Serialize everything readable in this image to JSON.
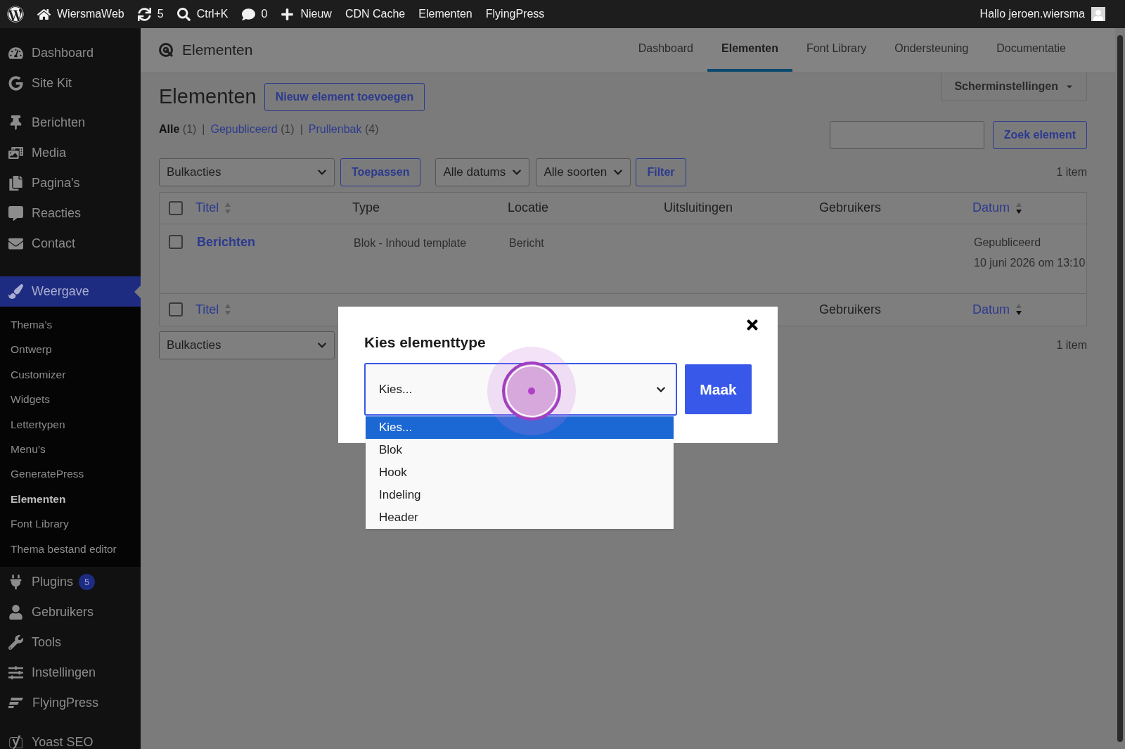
{
  "admin_bar": {
    "items": [
      {
        "kind": "logo"
      },
      {
        "kind": "home",
        "label": "WiersmaWeb"
      },
      {
        "kind": "updates",
        "label": "5"
      },
      {
        "kind": "search",
        "label": "Ctrl+K"
      },
      {
        "kind": "comments",
        "label": "0"
      },
      {
        "kind": "new",
        "label": "Nieuw"
      },
      {
        "kind": "text",
        "label": "CDN Cache"
      },
      {
        "kind": "text",
        "label": "Elementen"
      },
      {
        "kind": "text",
        "label": "FlyingPress"
      }
    ],
    "greeting": "Hallo jeroen.wiersma"
  },
  "sidebar": {
    "items": [
      {
        "label": "Dashboard",
        "selected": false
      },
      {
        "label": "Site Kit",
        "selected": false
      },
      {
        "label": "Berichten",
        "selected": false
      },
      {
        "label": "Media",
        "selected": false
      },
      {
        "label": "Pagina's",
        "selected": false
      },
      {
        "label": "Reacties",
        "selected": false
      },
      {
        "label": "Contact",
        "selected": false
      },
      {
        "label": "Weergave",
        "selected": true,
        "children": [
          {
            "label": "Thema’s",
            "selected": false
          },
          {
            "label": "Ontwerp",
            "selected": false
          },
          {
            "label": "Customizer",
            "selected": false
          },
          {
            "label": "Widgets",
            "selected": false
          },
          {
            "label": "Lettertypen",
            "selected": false
          },
          {
            "label": "Menu’s",
            "selected": false
          },
          {
            "label": "GeneratePress",
            "selected": false
          },
          {
            "label": "Elementen",
            "selected": true
          },
          {
            "label": "Font Library",
            "selected": false
          },
          {
            "label": "Thema bestand editor",
            "selected": false
          }
        ]
      },
      {
        "label": "Plugins",
        "selected": false,
        "badge": "5"
      },
      {
        "label": "Gebruikers",
        "selected": false
      },
      {
        "label": "Tools",
        "selected": false
      },
      {
        "label": "Instellingen",
        "selected": false
      },
      {
        "label": "FlyingPress",
        "selected": false
      },
      {
        "label": "Yoast SEO",
        "selected": false
      }
    ]
  },
  "plugin_header": {
    "title": "Elementen",
    "tabs": [
      {
        "label": "Dashboard",
        "selected": false
      },
      {
        "label": "Elementen",
        "selected": true
      },
      {
        "label": "Font Library",
        "selected": false
      },
      {
        "label": "Ondersteuning",
        "selected": false
      },
      {
        "label": "Documentatie",
        "selected": false
      }
    ]
  },
  "page": {
    "heading": "Elementen",
    "add_button": "Nieuw element toevoegen",
    "screen_options": "Scherminstellingen",
    "status_filters": [
      {
        "label": "Alle",
        "count": "(1)",
        "selected": true
      },
      {
        "separator": "|",
        "label": "Gepubliceerd",
        "count": "(1)",
        "selected": false
      },
      {
        "separator": "|",
        "label": "Prullenbak",
        "count": "(4)",
        "selected": false
      }
    ],
    "search_button": "Zoek element"
  },
  "toolbar": {
    "bulk_actions": "Bulkacties",
    "apply": "Toepassen",
    "dates": "Alle datums",
    "types": "Alle soorten",
    "filter": "Filter",
    "count": "1 item"
  },
  "table": {
    "select_all_checked": false,
    "columns": [
      {
        "label": "Titel",
        "sortable": true,
        "sorted_desc": false
      },
      {
        "label": "Type",
        "sortable": false
      },
      {
        "label": "Locatie",
        "sortable": false
      },
      {
        "label": "Uitsluitingen",
        "sortable": false
      },
      {
        "label": "Gebruikers",
        "sortable": false
      },
      {
        "label": "Datum",
        "sortable": true,
        "sorted_desc": true
      }
    ],
    "rows": [
      {
        "checked": false,
        "title": "Berichten",
        "type": "Blok - Inhoud template",
        "location": "Bericht",
        "status": "Gepubliceerd",
        "date": "10 juni 2026 om 13:10"
      }
    ],
    "footer_checked": false,
    "footer_columns": [
      {
        "label": "Titel",
        "sortable": true,
        "sorted_desc": false
      },
      {
        "label": "Gebruikers",
        "sortable": false
      },
      {
        "label": "Datum",
        "sortable": true,
        "sorted_desc": true
      }
    ]
  },
  "bottom_toolbar": {
    "bulk_actions": "Bulkacties",
    "count": "1 item"
  },
  "modal": {
    "title": "Kies elementtype",
    "select_value": "Kies...",
    "options": [
      {
        "label": "Kies...",
        "selected": true
      },
      {
        "label": "Blok",
        "selected": false
      },
      {
        "label": "Hook",
        "selected": false
      },
      {
        "label": "Indeling",
        "selected": false
      },
      {
        "label": "Header",
        "selected": false
      }
    ],
    "button": "Maak"
  }
}
